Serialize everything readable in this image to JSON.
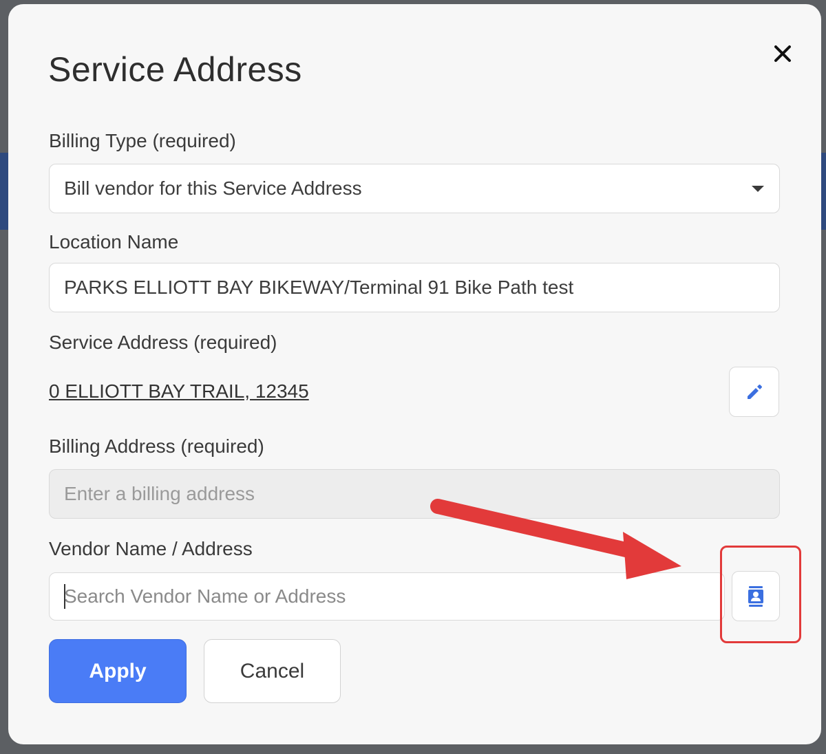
{
  "dialog": {
    "title": "Service Address",
    "close_icon": "close-icon"
  },
  "billing_type": {
    "label": "Billing Type (required)",
    "selected": "Bill vendor for this Service Address"
  },
  "location_name": {
    "label": "Location Name",
    "value": "PARKS ELLIOTT BAY BIKEWAY/Terminal 91 Bike Path test"
  },
  "service_address": {
    "label": "Service Address (required)",
    "value": "0 ELLIOTT BAY TRAIL, 12345",
    "edit_icon": "pencil-icon"
  },
  "billing_address": {
    "label": "Billing Address  (required)",
    "placeholder": "Enter a billing address"
  },
  "vendor": {
    "label": "Vendor Name / Address",
    "placeholder": "Search Vendor Name or Address",
    "contacts_icon": "address-book-icon"
  },
  "actions": {
    "apply_label": "Apply",
    "cancel_label": "Cancel"
  },
  "annotation": {
    "arrow_color": "#e23a3a",
    "highlight_color": "#e23a3a"
  },
  "colors": {
    "accent": "#4a7cf6"
  }
}
